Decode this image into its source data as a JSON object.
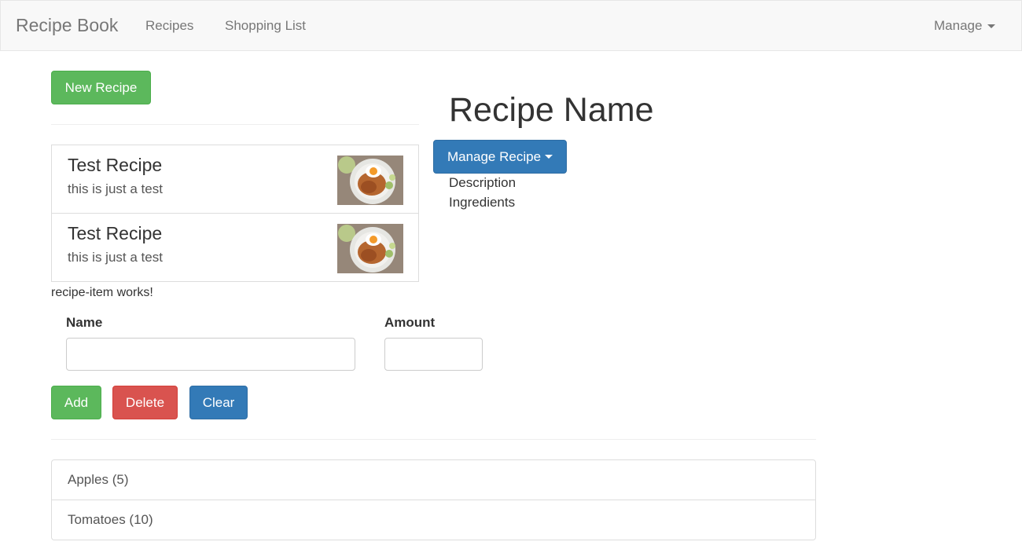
{
  "navbar": {
    "brand": "Recipe Book",
    "links": [
      "Recipes",
      "Shopping List"
    ],
    "manage_label": "Manage"
  },
  "recipes": {
    "new_button": "New Recipe",
    "items": [
      {
        "title": "Test Recipe",
        "description": "this is just a test",
        "image": "rice-dish-with-egg"
      },
      {
        "title": "Test Recipe",
        "description": "this is just a test",
        "image": "rice-dish-with-egg"
      }
    ],
    "item_works_text": "recipe-item works!"
  },
  "detail": {
    "title": "Recipe Name",
    "manage_button": "Manage Recipe",
    "description_label": "Description",
    "ingredients_label": "Ingredients"
  },
  "shopping_edit": {
    "name_label": "Name",
    "amount_label": "Amount",
    "name_value": "",
    "amount_value": "",
    "add_button": "Add",
    "delete_button": "Delete",
    "clear_button": "Clear"
  },
  "shopping_list": [
    "Apples (5)",
    "Tomatoes (10)"
  ],
  "colors": {
    "success": "#5cb85c",
    "danger": "#d9534f",
    "primary": "#337ab7",
    "navbar_bg": "#f8f8f8"
  }
}
